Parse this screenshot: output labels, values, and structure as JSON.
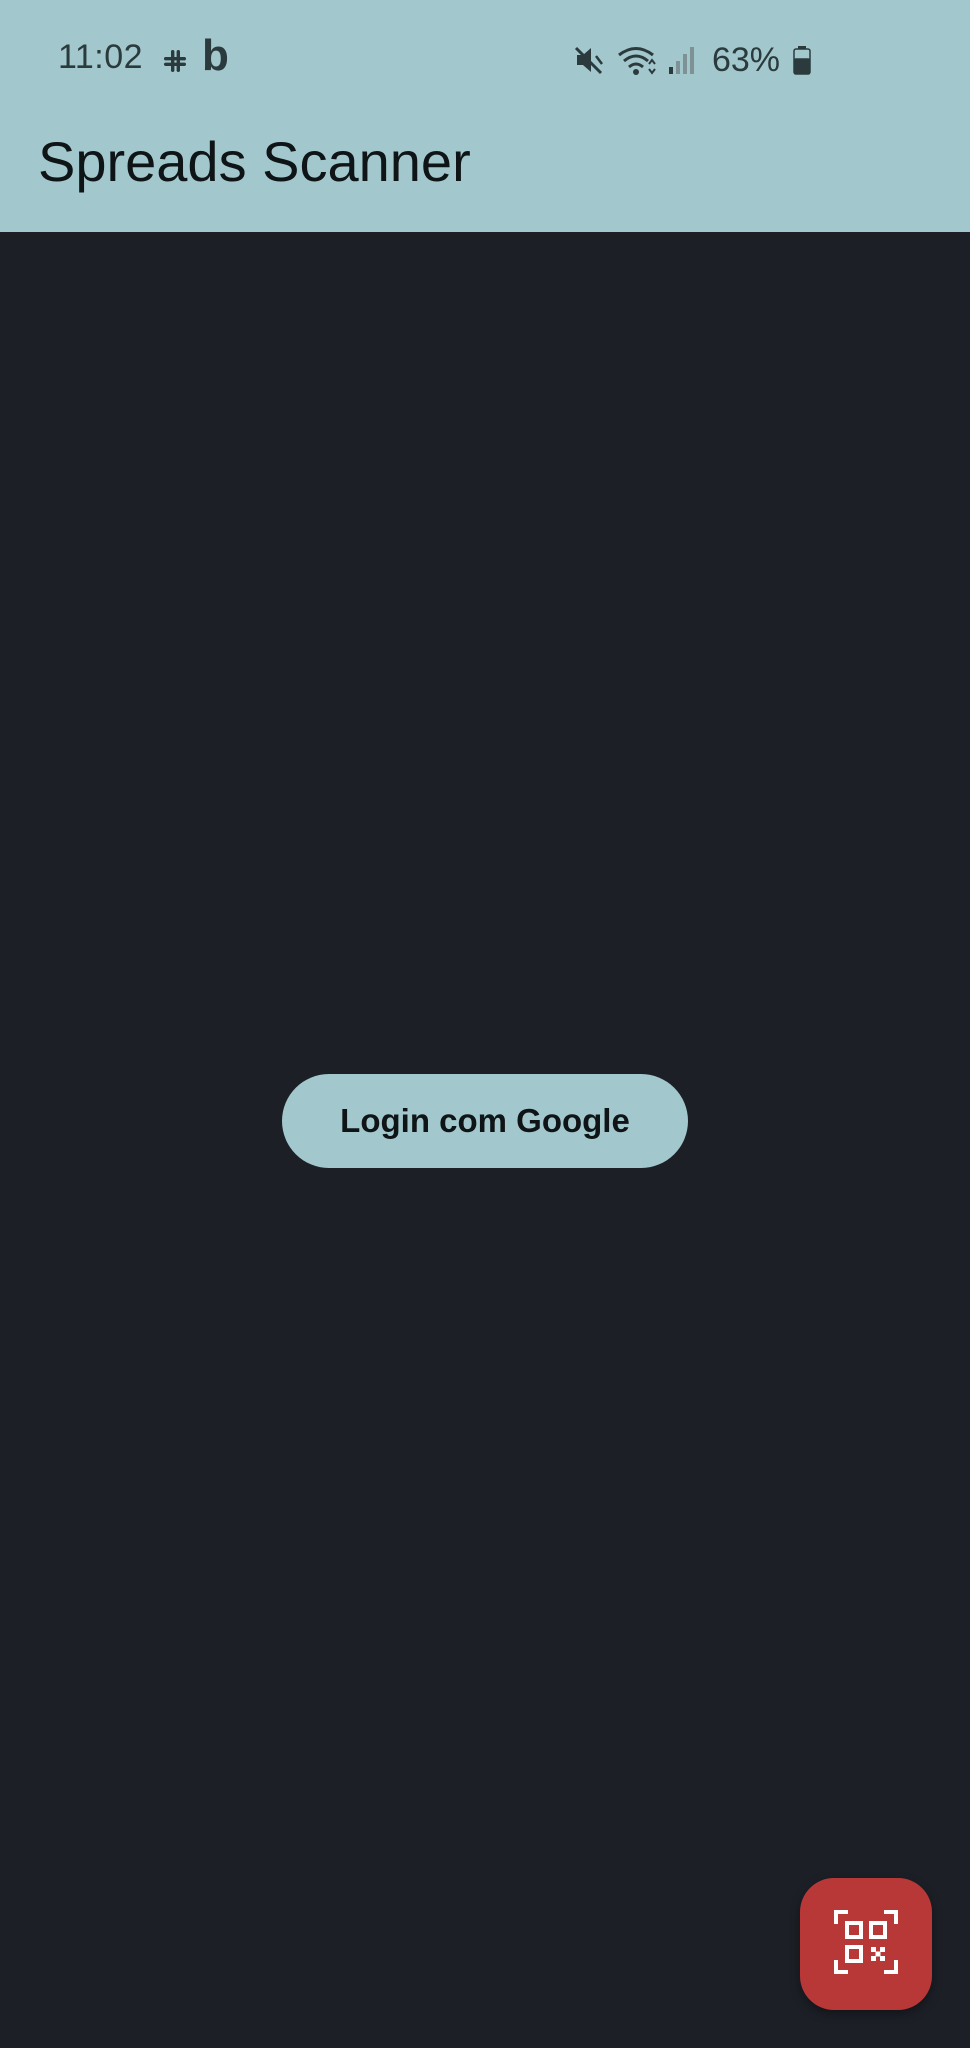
{
  "status_bar": {
    "time": "11:02",
    "notification_icons": [
      "slack-icon",
      "b-icon"
    ],
    "b_label": "b",
    "system_icons": [
      "mute-icon",
      "wifi-icon",
      "signal-icon"
    ],
    "battery_percent": "63%",
    "battery_level": 0.63
  },
  "app_bar": {
    "title": "Spreads Scanner"
  },
  "main": {
    "login_button_label": "Login com Google"
  },
  "fab": {
    "icon": "qr-code-scan-icon"
  },
  "colors": {
    "app_bar_bg": "#a2c8cd",
    "screen_bg": "#1c1f26",
    "fab_bg": "#b83838"
  }
}
